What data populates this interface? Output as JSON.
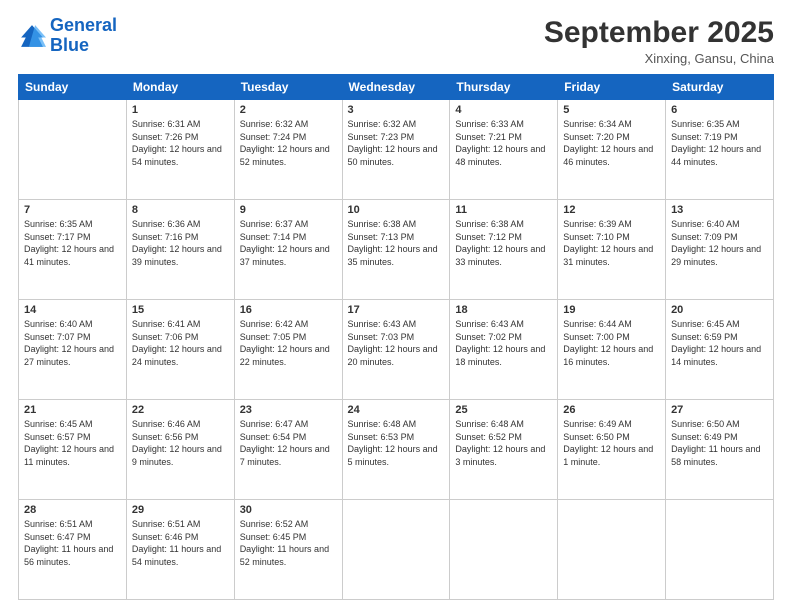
{
  "logo": {
    "line1": "General",
    "line2": "Blue"
  },
  "header": {
    "month_title": "September 2025",
    "subtitle": "Xinxing, Gansu, China"
  },
  "weekdays": [
    "Sunday",
    "Monday",
    "Tuesday",
    "Wednesday",
    "Thursday",
    "Friday",
    "Saturday"
  ],
  "weeks": [
    [
      {
        "day": "",
        "sunrise": "",
        "sunset": "",
        "daylight": ""
      },
      {
        "day": "1",
        "sunrise": "Sunrise: 6:31 AM",
        "sunset": "Sunset: 7:26 PM",
        "daylight": "Daylight: 12 hours and 54 minutes."
      },
      {
        "day": "2",
        "sunrise": "Sunrise: 6:32 AM",
        "sunset": "Sunset: 7:24 PM",
        "daylight": "Daylight: 12 hours and 52 minutes."
      },
      {
        "day": "3",
        "sunrise": "Sunrise: 6:32 AM",
        "sunset": "Sunset: 7:23 PM",
        "daylight": "Daylight: 12 hours and 50 minutes."
      },
      {
        "day": "4",
        "sunrise": "Sunrise: 6:33 AM",
        "sunset": "Sunset: 7:21 PM",
        "daylight": "Daylight: 12 hours and 48 minutes."
      },
      {
        "day": "5",
        "sunrise": "Sunrise: 6:34 AM",
        "sunset": "Sunset: 7:20 PM",
        "daylight": "Daylight: 12 hours and 46 minutes."
      },
      {
        "day": "6",
        "sunrise": "Sunrise: 6:35 AM",
        "sunset": "Sunset: 7:19 PM",
        "daylight": "Daylight: 12 hours and 44 minutes."
      }
    ],
    [
      {
        "day": "7",
        "sunrise": "Sunrise: 6:35 AM",
        "sunset": "Sunset: 7:17 PM",
        "daylight": "Daylight: 12 hours and 41 minutes."
      },
      {
        "day": "8",
        "sunrise": "Sunrise: 6:36 AM",
        "sunset": "Sunset: 7:16 PM",
        "daylight": "Daylight: 12 hours and 39 minutes."
      },
      {
        "day": "9",
        "sunrise": "Sunrise: 6:37 AM",
        "sunset": "Sunset: 7:14 PM",
        "daylight": "Daylight: 12 hours and 37 minutes."
      },
      {
        "day": "10",
        "sunrise": "Sunrise: 6:38 AM",
        "sunset": "Sunset: 7:13 PM",
        "daylight": "Daylight: 12 hours and 35 minutes."
      },
      {
        "day": "11",
        "sunrise": "Sunrise: 6:38 AM",
        "sunset": "Sunset: 7:12 PM",
        "daylight": "Daylight: 12 hours and 33 minutes."
      },
      {
        "day": "12",
        "sunrise": "Sunrise: 6:39 AM",
        "sunset": "Sunset: 7:10 PM",
        "daylight": "Daylight: 12 hours and 31 minutes."
      },
      {
        "day": "13",
        "sunrise": "Sunrise: 6:40 AM",
        "sunset": "Sunset: 7:09 PM",
        "daylight": "Daylight: 12 hours and 29 minutes."
      }
    ],
    [
      {
        "day": "14",
        "sunrise": "Sunrise: 6:40 AM",
        "sunset": "Sunset: 7:07 PM",
        "daylight": "Daylight: 12 hours and 27 minutes."
      },
      {
        "day": "15",
        "sunrise": "Sunrise: 6:41 AM",
        "sunset": "Sunset: 7:06 PM",
        "daylight": "Daylight: 12 hours and 24 minutes."
      },
      {
        "day": "16",
        "sunrise": "Sunrise: 6:42 AM",
        "sunset": "Sunset: 7:05 PM",
        "daylight": "Daylight: 12 hours and 22 minutes."
      },
      {
        "day": "17",
        "sunrise": "Sunrise: 6:43 AM",
        "sunset": "Sunset: 7:03 PM",
        "daylight": "Daylight: 12 hours and 20 minutes."
      },
      {
        "day": "18",
        "sunrise": "Sunrise: 6:43 AM",
        "sunset": "Sunset: 7:02 PM",
        "daylight": "Daylight: 12 hours and 18 minutes."
      },
      {
        "day": "19",
        "sunrise": "Sunrise: 6:44 AM",
        "sunset": "Sunset: 7:00 PM",
        "daylight": "Daylight: 12 hours and 16 minutes."
      },
      {
        "day": "20",
        "sunrise": "Sunrise: 6:45 AM",
        "sunset": "Sunset: 6:59 PM",
        "daylight": "Daylight: 12 hours and 14 minutes."
      }
    ],
    [
      {
        "day": "21",
        "sunrise": "Sunrise: 6:45 AM",
        "sunset": "Sunset: 6:57 PM",
        "daylight": "Daylight: 12 hours and 11 minutes."
      },
      {
        "day": "22",
        "sunrise": "Sunrise: 6:46 AM",
        "sunset": "Sunset: 6:56 PM",
        "daylight": "Daylight: 12 hours and 9 minutes."
      },
      {
        "day": "23",
        "sunrise": "Sunrise: 6:47 AM",
        "sunset": "Sunset: 6:54 PM",
        "daylight": "Daylight: 12 hours and 7 minutes."
      },
      {
        "day": "24",
        "sunrise": "Sunrise: 6:48 AM",
        "sunset": "Sunset: 6:53 PM",
        "daylight": "Daylight: 12 hours and 5 minutes."
      },
      {
        "day": "25",
        "sunrise": "Sunrise: 6:48 AM",
        "sunset": "Sunset: 6:52 PM",
        "daylight": "Daylight: 12 hours and 3 minutes."
      },
      {
        "day": "26",
        "sunrise": "Sunrise: 6:49 AM",
        "sunset": "Sunset: 6:50 PM",
        "daylight": "Daylight: 12 hours and 1 minute."
      },
      {
        "day": "27",
        "sunrise": "Sunrise: 6:50 AM",
        "sunset": "Sunset: 6:49 PM",
        "daylight": "Daylight: 11 hours and 58 minutes."
      }
    ],
    [
      {
        "day": "28",
        "sunrise": "Sunrise: 6:51 AM",
        "sunset": "Sunset: 6:47 PM",
        "daylight": "Daylight: 11 hours and 56 minutes."
      },
      {
        "day": "29",
        "sunrise": "Sunrise: 6:51 AM",
        "sunset": "Sunset: 6:46 PM",
        "daylight": "Daylight: 11 hours and 54 minutes."
      },
      {
        "day": "30",
        "sunrise": "Sunrise: 6:52 AM",
        "sunset": "Sunset: 6:45 PM",
        "daylight": "Daylight: 11 hours and 52 minutes."
      },
      {
        "day": "",
        "sunrise": "",
        "sunset": "",
        "daylight": ""
      },
      {
        "day": "",
        "sunrise": "",
        "sunset": "",
        "daylight": ""
      },
      {
        "day": "",
        "sunrise": "",
        "sunset": "",
        "daylight": ""
      },
      {
        "day": "",
        "sunrise": "",
        "sunset": "",
        "daylight": ""
      }
    ]
  ]
}
